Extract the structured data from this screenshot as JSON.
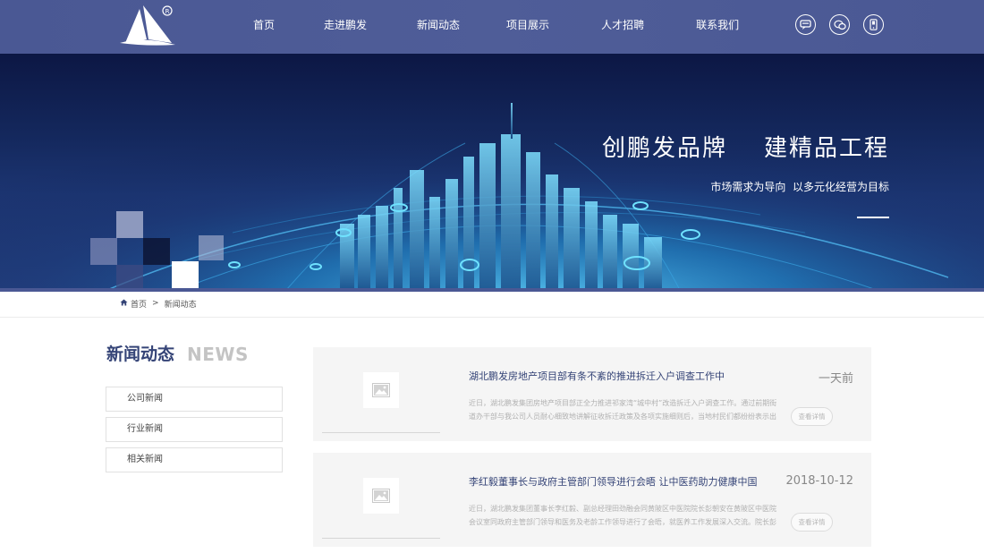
{
  "header": {
    "nav": [
      "首页",
      "走进鹏发",
      "新闻动态",
      "项目展示",
      "人才招聘",
      "联系我们"
    ],
    "icons": [
      "chat-icon",
      "wechat-icon",
      "mobile-icon"
    ],
    "logo_mark": "®"
  },
  "banner": {
    "title": "创鹏发品牌    建精品工程",
    "subtitle": "市场需求为导向  以多元化经营为目标"
  },
  "breadcrumb": {
    "home": "首页",
    "separator": ">",
    "current": "新闻动态"
  },
  "sidebar": {
    "title": "新闻动态",
    "title_en": "NEWS",
    "items": [
      "公司新闻",
      "行业新闻",
      "相关新闻"
    ]
  },
  "news": [
    {
      "title": "湖北鹏发房地产项目部有条不紊的推进拆迁入户调查工作中",
      "date": "一天前",
      "summary": "近日，湖北鹏发集团房地产项目部正全力推进祁家湾“城中村”改造拆迁入户调查工作。通过前期街道办干部与我公司人员耐心细致地讲解征收拆迁政策及各项实施细则后，当地村民们都纷纷表示出理解",
      "more": "查看详情"
    },
    {
      "title": "李红毅董事长与政府主管部门领导进行会晤 让中医药助力健康中国",
      "date": "2018-10-12",
      "summary": "近日，湖北鹏发集团董事长李红毅、副总经理田劲融会同黄陂区中医院院长彭朝安在黄陂区中医院会议室同政府主管部门领导和医务及老龄工作领导进行了会晤，就医养工作发展深入交流。院长彭朝安",
      "more": "查看详情"
    }
  ],
  "colors": {
    "header_bg": "#4a5894",
    "accent": "#354477",
    "news_bg": "#f5f5f5"
  }
}
